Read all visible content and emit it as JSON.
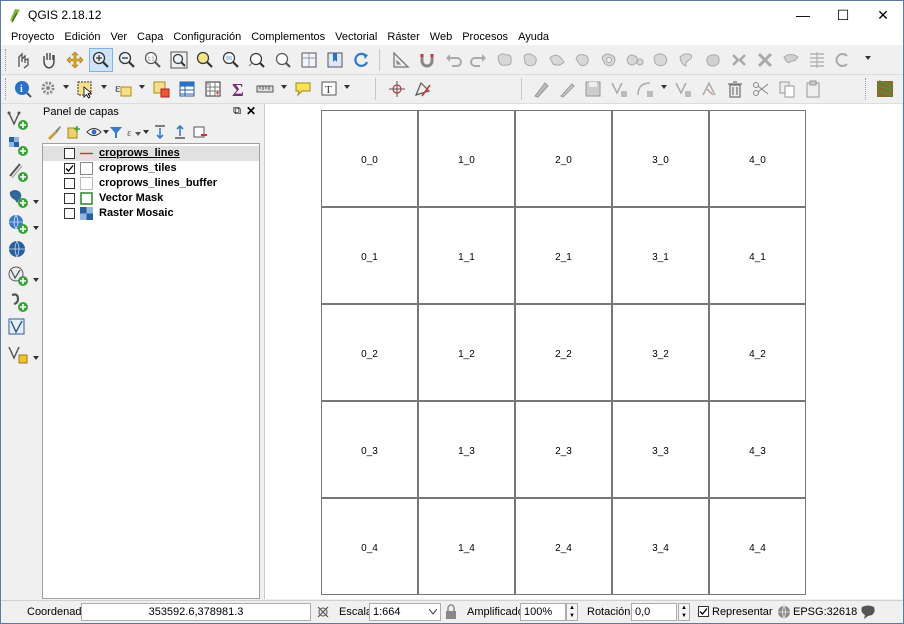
{
  "window": {
    "title": "QGIS 2.18.12",
    "minimize": "—",
    "maximize": "☐",
    "close": "✕"
  },
  "menu": [
    "Proyecto",
    "Edición",
    "Ver",
    "Capa",
    "Configuración",
    "Complementos",
    "Vectorial",
    "Ráster",
    "Web",
    "Procesos",
    "Ayuda"
  ],
  "layers_panel": {
    "title": "Panel de capas",
    "float_icon": "⧉",
    "close_icon": "✕",
    "layers": [
      {
        "name": "croprows_lines",
        "checked": false,
        "symbol": "line",
        "color": "#c0392b",
        "selected": true
      },
      {
        "name": "croprows_tiles",
        "checked": true,
        "symbol": "fill",
        "color": "#ffffff",
        "selected": false
      },
      {
        "name": "croprows_lines_buffer",
        "checked": false,
        "symbol": "fill",
        "color": "#ffffff",
        "selected": false
      },
      {
        "name": "Vector Mask",
        "checked": false,
        "symbol": "fill-outline",
        "color": "#3b8a3b",
        "selected": false
      },
      {
        "name": "Raster Mosaic",
        "checked": false,
        "symbol": "raster",
        "color": "#2a5f9e",
        "selected": false
      }
    ]
  },
  "map": {
    "tiles": [
      [
        "0_0",
        "1_0",
        "2_0",
        "3_0",
        "4_0"
      ],
      [
        "0_1",
        "1_1",
        "2_1",
        "3_1",
        "4_1"
      ],
      [
        "0_2",
        "1_2",
        "2_2",
        "3_2",
        "4_2"
      ],
      [
        "0_3",
        "1_3",
        "2_3",
        "3_3",
        "4_3"
      ],
      [
        "0_4",
        "1_4",
        "2_4",
        "3_4",
        "4_4"
      ]
    ]
  },
  "status": {
    "coord_label": "Coordenada",
    "coord_value": "353592.6,378981.3",
    "scale_label": "Escala",
    "scale_value": "1:664",
    "magnifier_label": "Amplificador",
    "magnifier_value": "100%",
    "rotation_label": "Rotación",
    "rotation_value": "0,0",
    "render_label": "Representar",
    "render_checked": true,
    "crs": "EPSG:32618"
  }
}
